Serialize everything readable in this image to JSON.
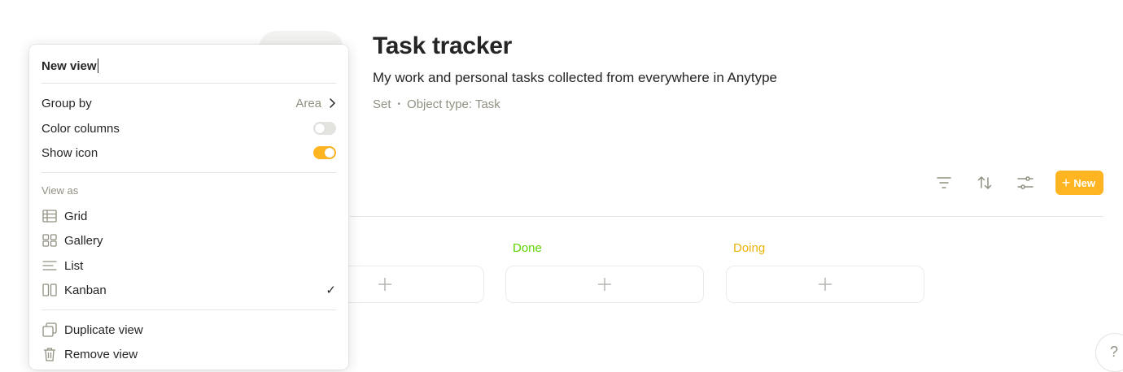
{
  "page": {
    "title": "Task tracker",
    "description": "My work and personal tasks collected from everywhere in Anytype",
    "meta_type": "Set",
    "meta_dot": "•",
    "meta_object_type": "Object type: Task"
  },
  "toolbar": {
    "filter_icon": "filter-icon",
    "sort_icon": "sort-icon",
    "settings_icon": "settings-sliders-icon",
    "new_label": "New",
    "new_plus": "+",
    "accent_color": "#ffb522"
  },
  "kanban": {
    "columns": [
      {
        "title": "",
        "color": "#252525"
      },
      {
        "title": "Done",
        "color": "#5dd400"
      },
      {
        "title": "Doing",
        "color": "#ecb20a"
      }
    ],
    "add_glyph": "+"
  },
  "menu": {
    "view_name": "New view",
    "group_by_label": "Group by",
    "group_by_value": "Area",
    "color_columns_label": "Color columns",
    "color_columns_on": false,
    "show_icon_label": "Show icon",
    "show_icon_on": true,
    "view_as_label": "View as",
    "views": [
      {
        "label": "Grid",
        "icon": "grid-icon",
        "selected": false
      },
      {
        "label": "Gallery",
        "icon": "gallery-icon",
        "selected": false
      },
      {
        "label": "List",
        "icon": "list-icon",
        "selected": false
      },
      {
        "label": "Kanban",
        "icon": "kanban-icon",
        "selected": true
      }
    ],
    "check_glyph": "✓",
    "duplicate_label": "Duplicate view",
    "remove_label": "Remove view"
  },
  "help": {
    "label": "?"
  }
}
